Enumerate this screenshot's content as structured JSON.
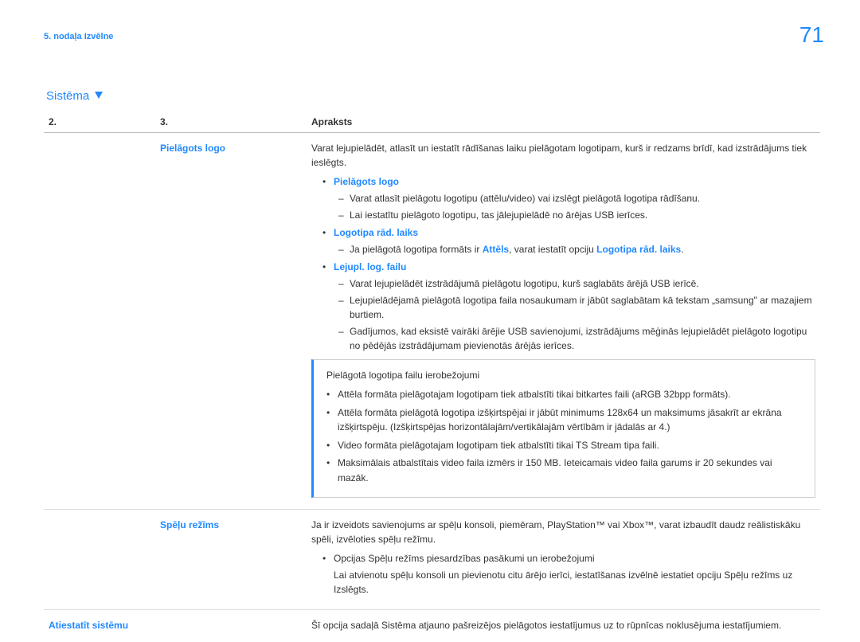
{
  "page_number": "71",
  "chapter": "5. nodaļa Izvēlne",
  "section_title": "Sistēma",
  "table": {
    "headers": {
      "col1": "2.",
      "col2": "3.",
      "col3": "Apraksts"
    },
    "rows": [
      {
        "feature": "Pielāgots logo",
        "intro": "Varat lejupielādēt, atlasīt un iestatīt rādīšanas laiku pielāgotam logotipam, kurš ir redzams brīdī, kad izstrādājums tiek ieslēgts.",
        "items": [
          {
            "label": "Pielāgots logo",
            "subitems": [
              "Varat atlasīt pielāgotu logotipu (attēlu/video) vai izslēgt pielāgotā logotipa rādīšanu.",
              "Lai iestatītu pielāgoto logotipu, tas jālejupielādē no ārējas USB ierīces."
            ]
          },
          {
            "label": "Logotipa rād. laiks",
            "subitems_mixed": {
              "prefix": "Ja pielāgotā logotipa formāts ir ",
              "link1": "Attēls",
              "mid": ", varat iestatīt opciju ",
              "link2": "Logotipa rād. laiks",
              "suffix": "."
            }
          },
          {
            "label": "Lejupl. log. failu",
            "subitems": [
              "Varat lejupielādēt izstrādājumā pielāgotu logotipu, kurš saglabāts ārējā USB ierīcē.",
              "Lejupielādējamā pielāgotā logotipa faila nosaukumam ir jābūt saglabātam kā tekstam „samsung\" ar mazajiem burtiem.",
              "Gadījumos, kad eksistē vairāki ārējie USB savienojumi, izstrādājums mēģinās lejupielādēt pielāgoto logotipu no pēdējās izstrādājumam pievienotās ārējās ierīces."
            ]
          }
        ],
        "infobox": {
          "title": "Pielāgotā logotipa failu ierobežojumi",
          "points": [
            "Attēla formāta pielāgotajam logotipam tiek atbalstīti tikai bitkartes faili (aRGB 32bpp formāts).",
            "Attēla formāta pielāgotā logotipa izšķirtspējai ir jābūt minimums 128x64 un maksimums jāsakrīt ar ekrāna izšķirtspēju. (Izšķirtspējas horizontālajām/vertikālajām vērtībām ir jādalās ar 4.)",
            "Video formāta pielāgotajam logotipam tiek atbalstīti tikai TS Stream tipa faili.",
            "Maksimālais atbalstītais video faila izmērs ir 150 MB. Ieteicamais video faila garums ir 20 sekundes vai mazāk."
          ]
        }
      },
      {
        "feature": "Spēļu režīms",
        "intro": "Ja ir izveidots savienojums ar spēļu konsoli, piemēram, PlayStation™ vai Xbox™, varat izbaudīt daudz reālistiskāku spēli, izvēloties spēļu režīmu.",
        "bullets": [
          {
            "text": "Opcijas Spēļu režīms piesardzības pasākumi un ierobežojumi",
            "note": "Lai atvienotu spēļu konsoli un pievienotu citu ārējo ierīci, iestatīšanas izvēlnē iestatiet opciju Spēļu režīms uz Izslēgts."
          }
        ]
      },
      {
        "feature": "Atiestatīt sistēmu",
        "intro": "Šī opcija sadaļā Sistēma atjauno pašreizējos pielāgotos iestatījumus uz to rūpnīcas noklusējuma iestatījumiem."
      }
    ]
  }
}
